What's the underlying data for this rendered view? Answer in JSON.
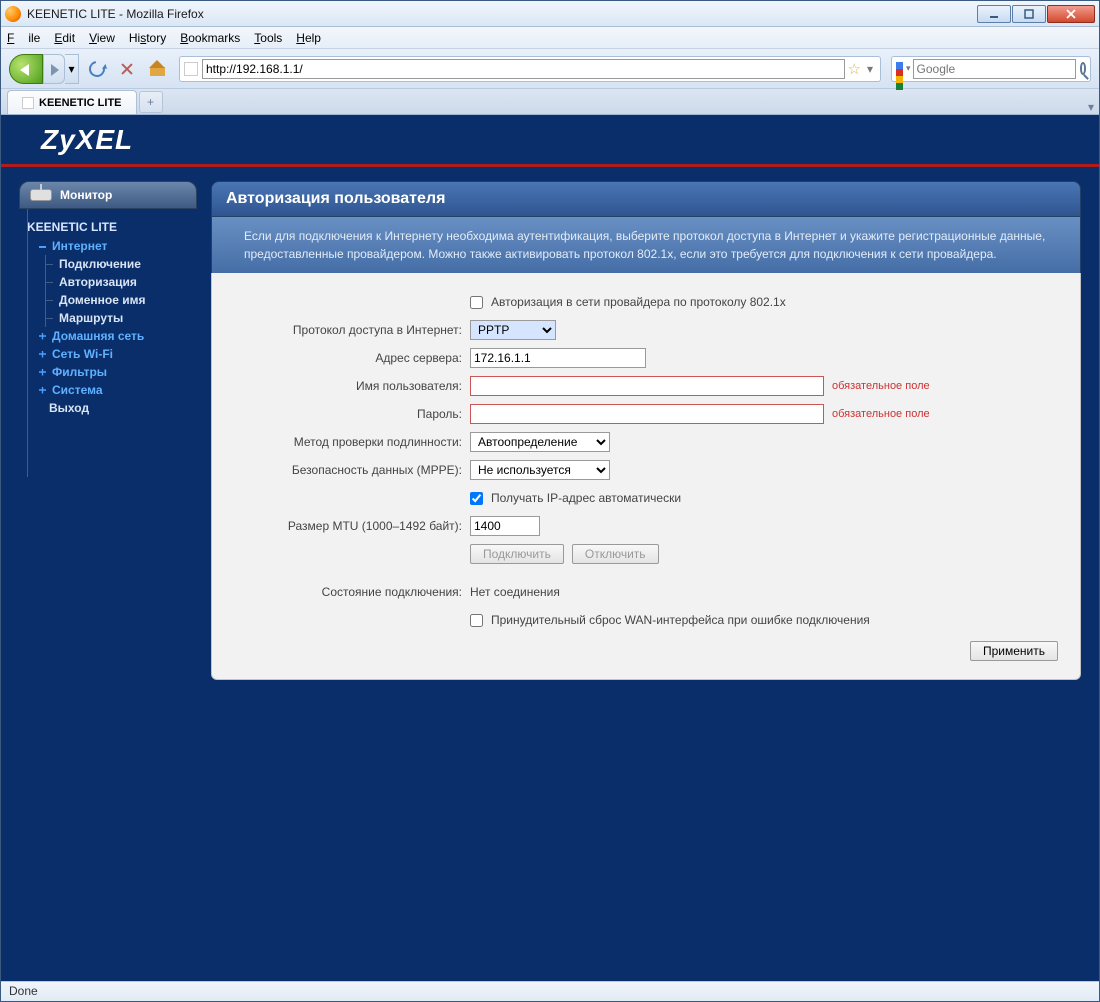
{
  "window": {
    "title": "KEENETIC LITE - Mozilla Firefox"
  },
  "menubar": {
    "file": "File",
    "edit": "Edit",
    "view": "View",
    "history": "History",
    "bookmarks": "Bookmarks",
    "tools": "Tools",
    "help": "Help"
  },
  "urlbar": {
    "value": "http://192.168.1.1/"
  },
  "searchbar": {
    "placeholder": "Google"
  },
  "tab": {
    "title": "KEENETIC LITE"
  },
  "brand": "ZyXEL",
  "sidebar": {
    "monitor_header": "Монитор",
    "device": "KEENETIC LITE",
    "items": [
      {
        "label": "Интернет",
        "type": "top",
        "expanded": true,
        "children": [
          {
            "label": "Подключение"
          },
          {
            "label": "Авторизация"
          },
          {
            "label": "Доменное имя"
          },
          {
            "label": "Маршруты"
          }
        ]
      },
      {
        "label": "Домашняя сеть",
        "type": "top"
      },
      {
        "label": "Сеть Wi-Fi",
        "type": "top"
      },
      {
        "label": "Фильтры",
        "type": "top"
      },
      {
        "label": "Система",
        "type": "top"
      },
      {
        "label": "Выход",
        "type": "plain"
      }
    ]
  },
  "panel": {
    "title": "Авторизация пользователя",
    "desc": "Если для подключения к Интернету необходима аутентификация, выберите протокол доступа в Интернет и укажите регистрационные данные, предоставленные провайдером. Можно также активировать протокол 802.1x, если это требуется для подключения к сети провайдера."
  },
  "form": {
    "chk_8021x_label": "Авторизация в сети провайдера по протоколу 802.1x",
    "protocol_label": "Протокол доступа в Интернет:",
    "protocol_value": "PPTP",
    "server_label": "Адрес сервера:",
    "server_value": "172.16.1.1",
    "user_label": "Имя пользователя:",
    "user_value": "",
    "pass_label": "Пароль:",
    "pass_value": "",
    "required_note": "обязательное поле",
    "auth_label": "Метод проверки подлинности:",
    "auth_value": "Автоопределение",
    "mppe_label": "Безопасность данных (MPPE):",
    "mppe_value": "Не используется",
    "auto_ip_label": "Получать IP-адрес автоматически",
    "mtu_label": "Размер MTU (1000–1492 байт):",
    "mtu_value": "1400",
    "btn_connect": "Подключить",
    "btn_disconnect": "Отключить",
    "conn_state_label": "Состояние подключения:",
    "conn_state_value": "Нет соединения",
    "wan_reset_label": "Принудительный сброс WAN-интерфейса при ошибке подключения",
    "btn_apply": "Применить"
  },
  "statusbar": {
    "text": "Done"
  }
}
